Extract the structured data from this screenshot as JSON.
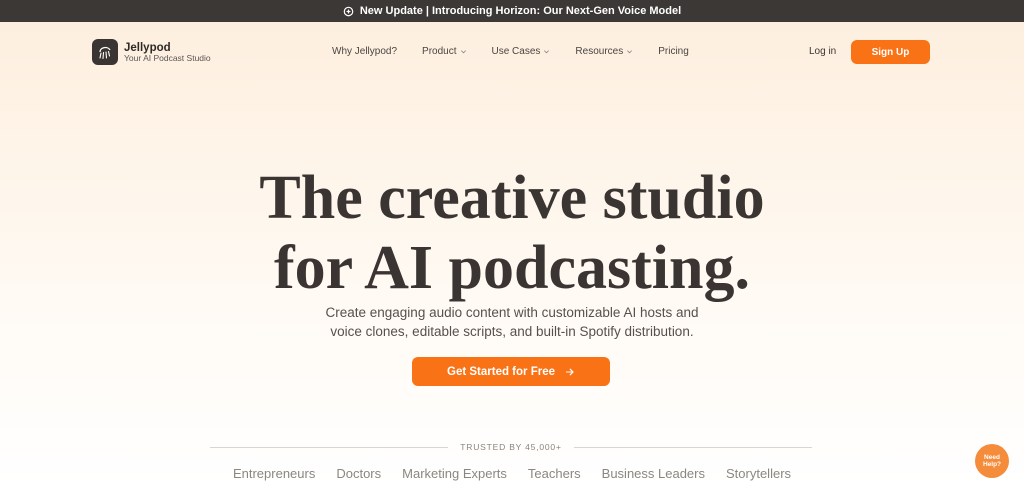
{
  "announcement": {
    "text": "New Update | Introducing Horizon: Our Next-Gen Voice Model",
    "icon": "sparkle-icon"
  },
  "brand": {
    "name": "Jellypod",
    "tagline": "Your AI Podcast Studio",
    "icon": "jellyfish-logo-icon"
  },
  "nav": {
    "items": [
      {
        "label": "Why Jellypod?",
        "dropdown": false
      },
      {
        "label": "Product",
        "dropdown": true
      },
      {
        "label": "Use Cases",
        "dropdown": true
      },
      {
        "label": "Resources",
        "dropdown": true
      },
      {
        "label": "Pricing",
        "dropdown": false
      }
    ],
    "login_label": "Log in",
    "signup_label": "Sign Up"
  },
  "hero": {
    "title_line1": "The creative studio",
    "title_line2": "for AI podcasting.",
    "subtitle_line1": "Create engaging audio content with customizable AI hosts and",
    "subtitle_line2": "voice clones, editable scripts, and built-in Spotify distribution.",
    "cta_label": "Get Started for Free",
    "cta_icon": "arrow-right-icon"
  },
  "trusted": {
    "label": "TRUSTED BY 45,000+",
    "audiences": [
      "Entrepreneurs",
      "Doctors",
      "Marketing Experts",
      "Teachers",
      "Business Leaders",
      "Storytellers"
    ]
  },
  "help_widget": {
    "label": "Need Help?"
  },
  "colors": {
    "accent": "#f97316",
    "announce_bg": "#3b3836",
    "text_dark": "#3a3532"
  }
}
